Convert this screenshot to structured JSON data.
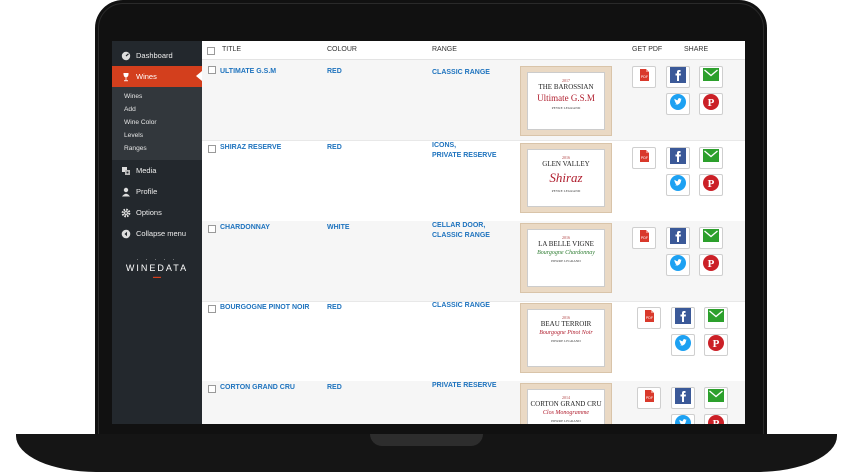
{
  "sidebar": {
    "items": [
      {
        "label": "Dashboard",
        "icon": "dashboard-icon"
      },
      {
        "label": "Wines",
        "icon": "wine-glass-icon"
      },
      {
        "label": "Media",
        "icon": "media-icon"
      },
      {
        "label": "Profile",
        "icon": "user-icon"
      },
      {
        "label": "Options",
        "icon": "gear-icon"
      },
      {
        "label": "Collapse menu",
        "icon": "collapse-icon"
      }
    ],
    "submenu": [
      "Wines",
      "Add",
      "Wine Color",
      "Levels",
      "Ranges"
    ],
    "logo": "WINEDATA"
  },
  "table": {
    "headers": {
      "title": "TITLE",
      "colour": "COLOUR",
      "range": "RANGE",
      "get_pdf": "GET PDF",
      "share": "SHARE"
    },
    "rows": [
      {
        "title": "ULTIMATE G.S.M",
        "colour": "RED",
        "range": [
          "CLASSIC RANGE"
        ],
        "label": {
          "year": "2017",
          "top": "THE BAROSSIAN",
          "main": "Ultimate G.S.M",
          "foot": "PEYRE LEGRAND"
        }
      },
      {
        "title": "SHIRAZ RESERVE",
        "colour": "RED",
        "range": [
          "ICONS,",
          "PRIVATE RESERVE"
        ],
        "label": {
          "year": "2016",
          "top": "GLEN VALLEY",
          "main": "Shiraz",
          "foot": "PEYRE LEGRAND"
        }
      },
      {
        "title": "CHARDONNAY",
        "colour": "WHITE",
        "range": [
          "CELLAR DOOR,",
          "CLASSIC RANGE"
        ],
        "label": {
          "year": "2016",
          "top": "LA BELLE VIGNE",
          "main": "Bourgogne Chardonnay",
          "foot": "PIERRE LEGRAND"
        }
      },
      {
        "title": "BOURGOGNE PINOT NOIR",
        "colour": "RED",
        "range": [
          "CLASSIC RANGE"
        ],
        "label": {
          "year": "2016",
          "top": "BEAU TERROIR",
          "main": "Bourgogne Pinot Noir",
          "foot": "PIERRE LEGRAND"
        }
      },
      {
        "title": "CORTON GRAND CRU",
        "colour": "RED",
        "range": [
          "PRIVATE RESERVE"
        ],
        "label": {
          "year": "2014",
          "top": "CORTON GRAND CRU",
          "main": "Clos Monogramme",
          "foot": "PIERRE LEGRAND"
        }
      }
    ]
  },
  "colors": {
    "accent": "#d33f1d",
    "link": "#1e73be",
    "sidebar_bg": "#23282d",
    "facebook": "#3b5998",
    "twitter": "#1da1f2",
    "pinterest": "#cb2027",
    "email": "#2ca02c",
    "pdf": "#d9392b",
    "label_red": "#b01e2e",
    "label_green": "#2e7d32"
  }
}
